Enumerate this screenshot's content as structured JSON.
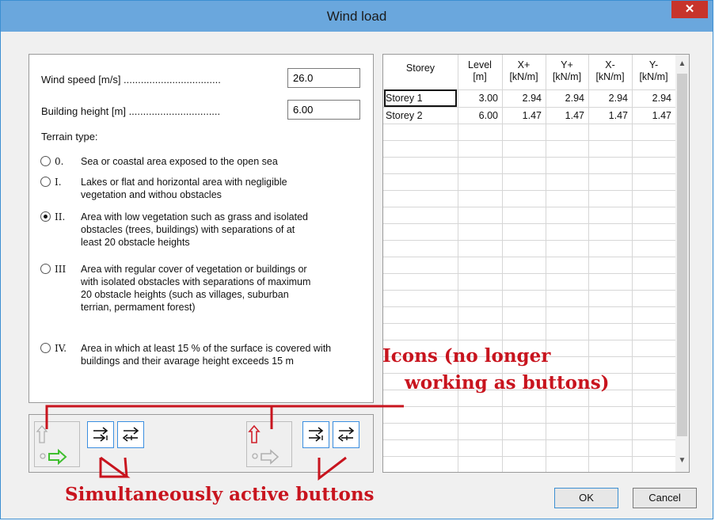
{
  "window": {
    "title": "Wind load",
    "close_glyph": "✕"
  },
  "form": {
    "wind_speed_label": "Wind speed [m/s] ..................................",
    "wind_speed_value": "26.0",
    "building_height_label": "Building height [m] ................................",
    "building_height_value": "6.00",
    "terrain_type_label": "Terrain type:"
  },
  "terrain_options": [
    {
      "code": "0.",
      "text": "Sea or coastal area exposed to the open sea",
      "selected": false
    },
    {
      "code": "I.",
      "text": "Lakes or flat and horizontal area with negligible vegetation and withou obstacles",
      "selected": false
    },
    {
      "code": "II.",
      "text": "Area with low vegetation such as grass and isolated obstacles (trees, buildings) with separations of at least 20 obstacle heights",
      "selected": true
    },
    {
      "code": "III",
      "text": "Area with regular cover of vegetation or buildings or with isolated obstacles with separations of maximum 20 obstacle heights (such as villages, suburban terrian, permament forest)",
      "selected": false
    },
    {
      "code": "IV.",
      "text": "Area in which at least 15 % of the surface is covered with buildings and their avarage height exceeds 15 m",
      "selected": false
    }
  ],
  "table": {
    "headers": [
      {
        "line1": "Storey",
        "line2": ""
      },
      {
        "line1": "Level",
        "line2": "[m]"
      },
      {
        "line1": "X+",
        "line2": "[kN/m]"
      },
      {
        "line1": "Y+",
        "line2": "[kN/m]"
      },
      {
        "line1": "X-",
        "line2": "[kN/m]"
      },
      {
        "line1": "Y-",
        "line2": "[kN/m]"
      }
    ],
    "rows": [
      [
        "Storey 1",
        "3.00",
        "2.94",
        "2.94",
        "2.94",
        "2.94"
      ],
      [
        "Storey 2",
        "6.00",
        "1.47",
        "1.47",
        "1.47",
        "1.47"
      ]
    ]
  },
  "buttons": {
    "ok": "OK",
    "cancel": "Cancel"
  },
  "annotations": {
    "icons_line1": "Icons (no longer",
    "icons_line2": "working as buttons)",
    "buttons_note": "Simultaneously active buttons"
  },
  "colors": {
    "annotation_red": "#c8141e",
    "title_bar": "#6aa7dd",
    "close_button": "#c7342b",
    "tool_button_border": "#3a8ee0",
    "arrow_green": "#3fbf2f"
  }
}
